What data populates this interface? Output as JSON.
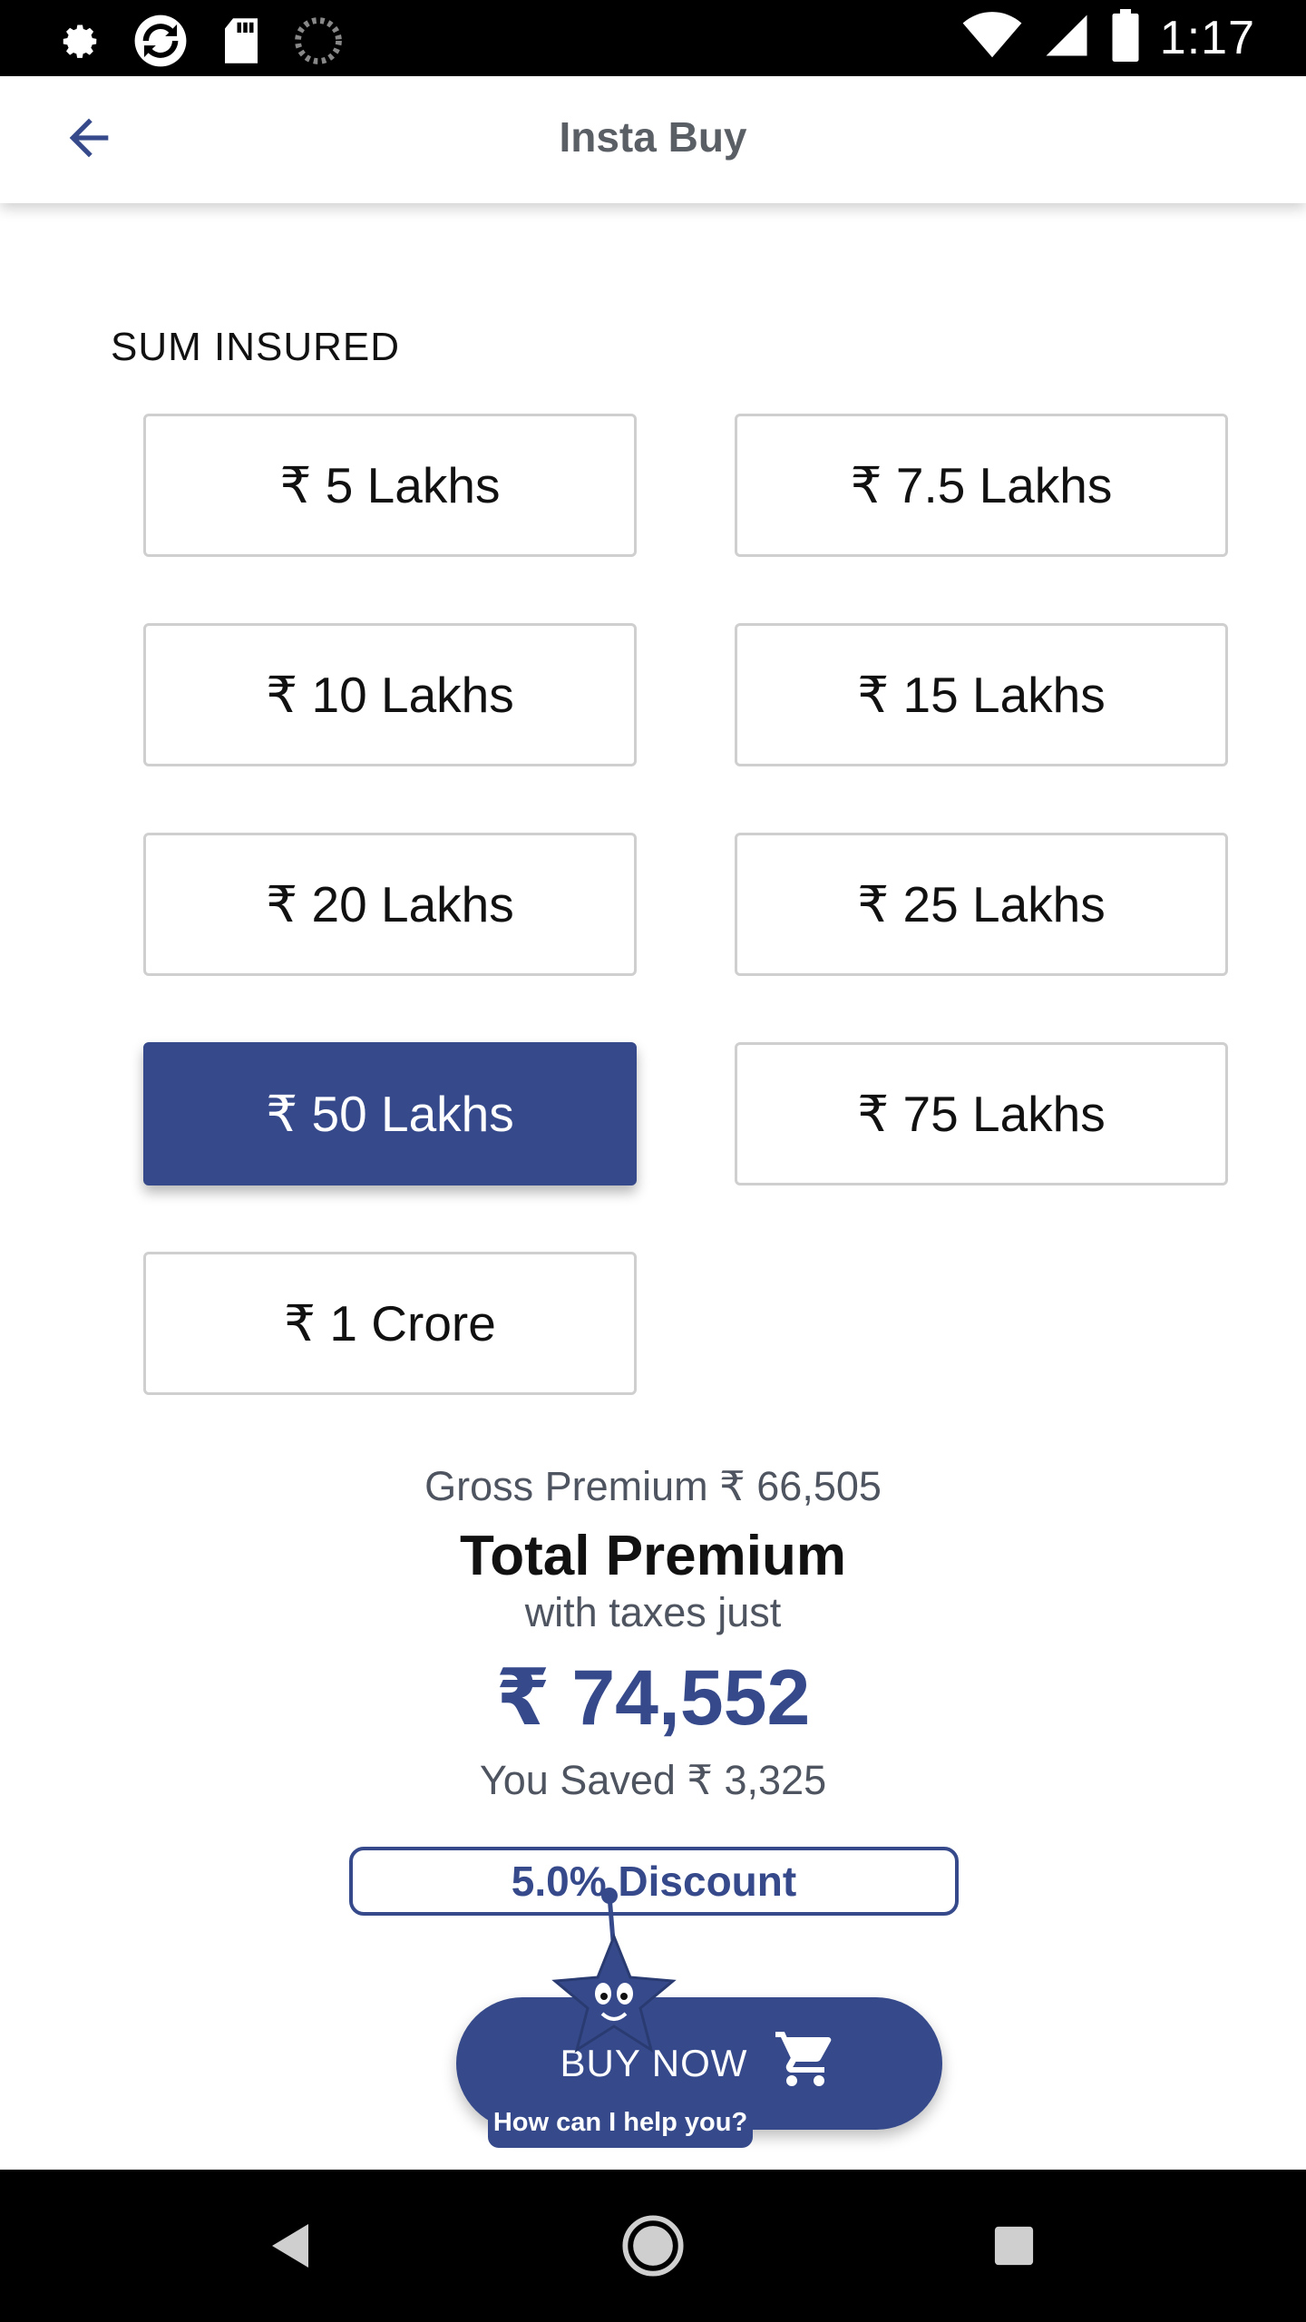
{
  "status_bar": {
    "time": "1:17",
    "left_icons": [
      "settings-icon",
      "sync-icon",
      "sd-card-icon",
      "loading-icon"
    ],
    "right_icons": [
      "wifi-icon",
      "signal-icon",
      "battery-icon"
    ]
  },
  "app_bar": {
    "title": "Insta Buy",
    "back_icon": "arrow-left-icon"
  },
  "sum_insured": {
    "label": "SUM INSURED",
    "options": [
      "₹ 5 Lakhs",
      "₹ 7.5 Lakhs",
      "₹ 10 Lakhs",
      "₹ 15 Lakhs",
      "₹ 20 Lakhs",
      "₹ 25 Lakhs",
      "₹ 50 Lakhs",
      "₹ 75 Lakhs",
      "₹ 1 Crore"
    ],
    "selected": "₹ 50 Lakhs"
  },
  "premium": {
    "gross": "Gross Premium ₹ 66,505",
    "total_title": "Total Premium",
    "with_taxes": "with taxes just",
    "total_amount": "₹ 74,552",
    "saved": "You Saved ₹ 3,325",
    "discount": "5.0% Discount"
  },
  "buy": {
    "label": "BUY NOW",
    "icon": "cart-icon"
  },
  "assistant": {
    "help_text": "How can I help you?"
  },
  "colors": {
    "primary": "#364a8b",
    "text": "#111111",
    "muted": "#4f5560",
    "border": "#cfcfcf"
  },
  "nav_bar": {
    "icons": [
      "back-triangle-icon",
      "home-circle-icon",
      "recents-square-icon"
    ]
  }
}
